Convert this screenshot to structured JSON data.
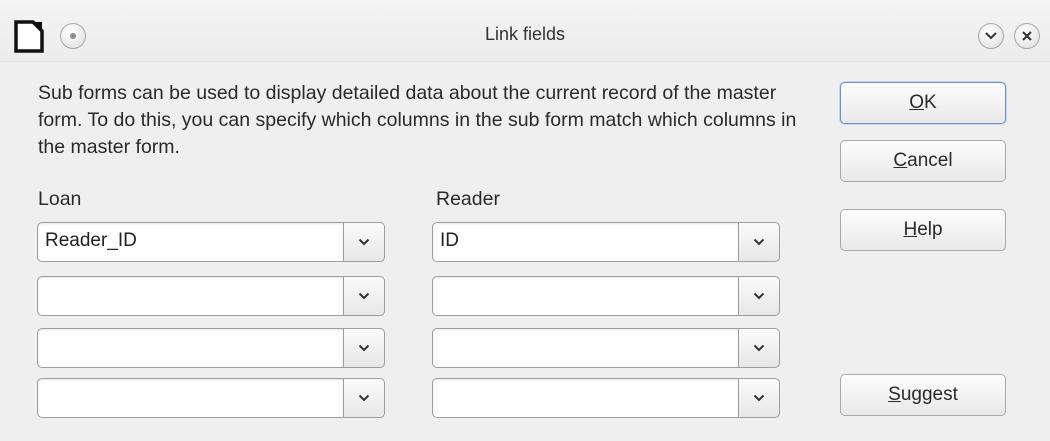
{
  "window": {
    "title": "Link fields"
  },
  "description": "Sub forms can be used to display detailed data about the current record of the master form. To do this, you can specify which columns in the sub form match which columns in the master form.",
  "columns": {
    "left_label": "Loan",
    "right_label": "Reader"
  },
  "rows": [
    {
      "left_value": "Reader_ID",
      "right_value": "ID"
    },
    {
      "left_value": "",
      "right_value": ""
    },
    {
      "left_value": "",
      "right_value": ""
    },
    {
      "left_value": "",
      "right_value": ""
    }
  ],
  "buttons": {
    "ok": {
      "mnemonic": "O",
      "rest": "K"
    },
    "cancel": {
      "mnemonic": "C",
      "rest": "ancel"
    },
    "help": {
      "mnemonic": "H",
      "rest": "elp"
    },
    "suggest": {
      "mnemonic": "S",
      "rest": "uggest"
    }
  },
  "icons": {
    "app": "document-icon",
    "menu": "window-menu-icon",
    "minimize": "chevron-down-icon",
    "close": "close-icon",
    "dropdown": "chevron-down-icon"
  }
}
